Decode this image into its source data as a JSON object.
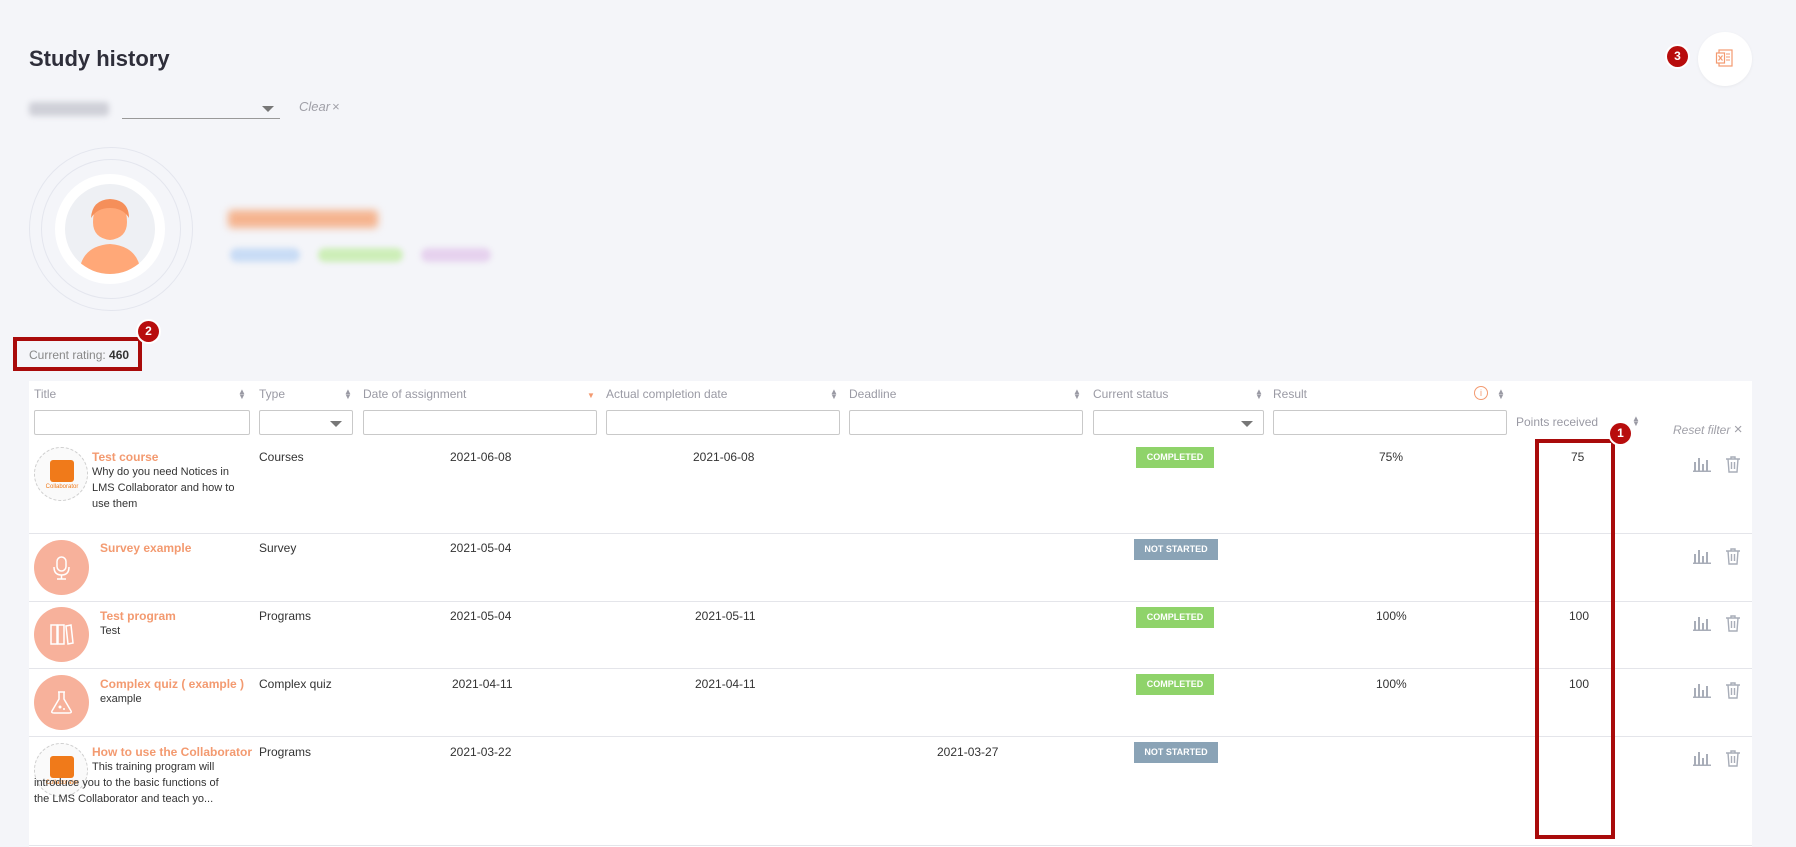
{
  "page": {
    "title": "Study history"
  },
  "filter": {
    "clear_label": "Clear",
    "clear_icon": "×"
  },
  "rating": {
    "label": "Current rating:",
    "value": "460"
  },
  "markers": {
    "m1": "1",
    "m2": "2",
    "m3": "3"
  },
  "table": {
    "columns": {
      "title": "Title",
      "type": "Type",
      "date_assigned": "Date of assignment",
      "actual_completion": "Actual completion date",
      "deadline": "Deadline",
      "status": "Current status",
      "result": "Result",
      "points": "Points received"
    },
    "reset_filter": "Reset filter",
    "reset_icon": "×",
    "info_icon": "i",
    "rows": [
      {
        "title": "Test course",
        "description": "Why do you need Notices in LMS Collaborator and how to use them",
        "type": "Courses",
        "assigned": "2021-06-08",
        "completed": "2021-06-08",
        "deadline": "",
        "status": "COMPLETED",
        "result": "75%",
        "points": "75",
        "thumb": "collaborator-logo-icon"
      },
      {
        "title": "Survey example",
        "description": "",
        "type": "Survey",
        "assigned": "2021-05-04",
        "completed": "",
        "deadline": "",
        "status": "NOT STARTED",
        "result": "",
        "points": "",
        "thumb": "microphone-icon"
      },
      {
        "title": "Test program",
        "description": "Test",
        "type": "Programs",
        "assigned": "2021-05-04",
        "completed": "2021-05-11",
        "deadline": "",
        "status": "COMPLETED",
        "result": "100%",
        "points": "100",
        "thumb": "books-icon"
      },
      {
        "title": "Complex quiz ( example )",
        "description": "example",
        "type": "Complex quiz",
        "assigned": "2021-04-11",
        "completed": "2021-04-11",
        "deadline": "",
        "status": "COMPLETED",
        "result": "100%",
        "points": "100",
        "thumb": "flask-icon"
      },
      {
        "title": "How to use the Collaborator",
        "description": "This training program will introduce you to the basic functions of the LMS Collaborator and teach yo...",
        "type": "Programs",
        "assigned": "2021-03-22",
        "completed": "",
        "deadline": "2021-03-27",
        "status": "NOT STARTED",
        "result": "",
        "points": "",
        "thumb": "collaborator-logo-icon"
      }
    ]
  },
  "logo_text": "Collaborator",
  "colors": {
    "accent": "#f39a70",
    "completed": "#8fd36a",
    "not_started": "#8aa3b6",
    "highlight": "#a90b0b"
  }
}
